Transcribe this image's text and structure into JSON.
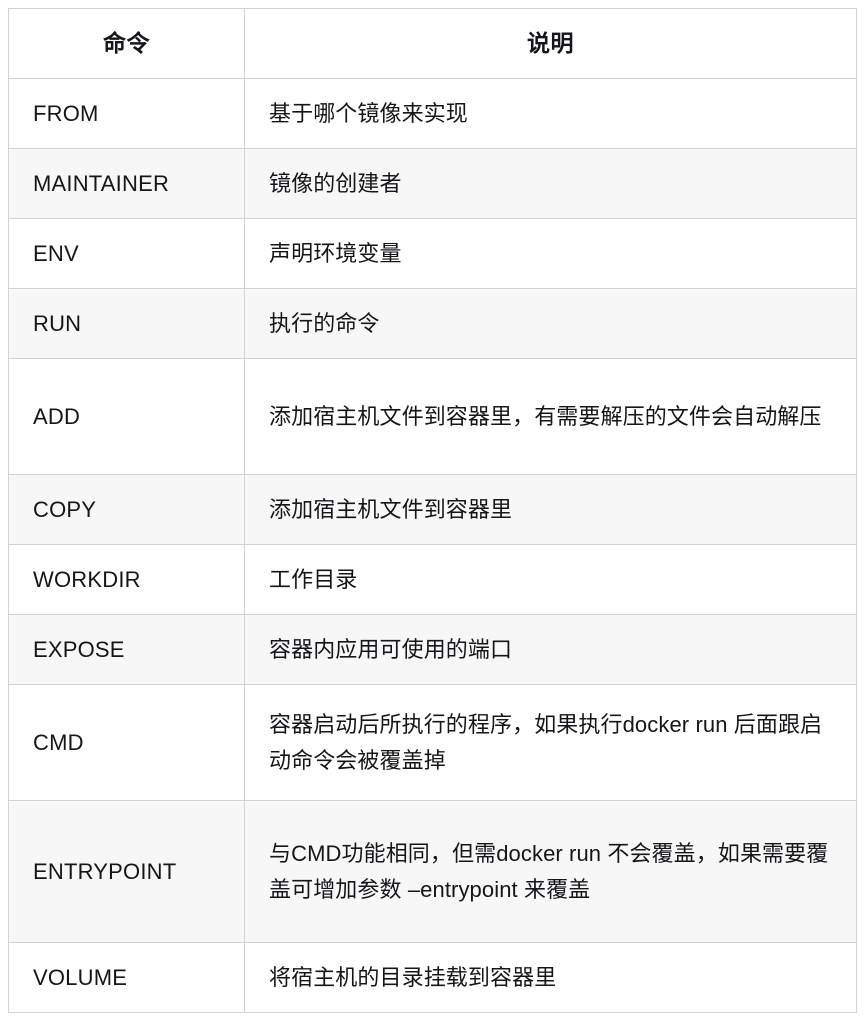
{
  "table": {
    "headers": {
      "command": "命令",
      "description": "说明"
    },
    "rows": [
      {
        "command": "FROM",
        "description": "基于哪个镜像来实现"
      },
      {
        "command": "MAINTAINER",
        "description": "镜像的创建者"
      },
      {
        "command": "ENV",
        "description": "声明环境变量"
      },
      {
        "command": "RUN",
        "description": "执行的命令"
      },
      {
        "command": "ADD",
        "description": "添加宿主机文件到容器里，有需要解压的文件会自动解压"
      },
      {
        "command": "COPY",
        "description": "添加宿主机文件到容器里"
      },
      {
        "command": "WORKDIR",
        "description": "工作目录"
      },
      {
        "command": "EXPOSE",
        "description": "容器内应用可使用的端口"
      },
      {
        "command": "CMD",
        "description": "容器启动后所执行的程序，如果执行docker run 后面跟启动命令会被覆盖掉"
      },
      {
        "command": "ENTRYPOINT",
        "description": "与CMD功能相同，但需docker run 不会覆盖，如果需要覆盖可增加参数 –entrypoint 来覆盖"
      },
      {
        "command": "VOLUME",
        "description": "将宿主机的目录挂载到容器里"
      }
    ]
  },
  "colors": {
    "border": "#d3d3d3",
    "stripe": "#f7f7f7",
    "background": "#ffffff",
    "text": "#16161a"
  }
}
